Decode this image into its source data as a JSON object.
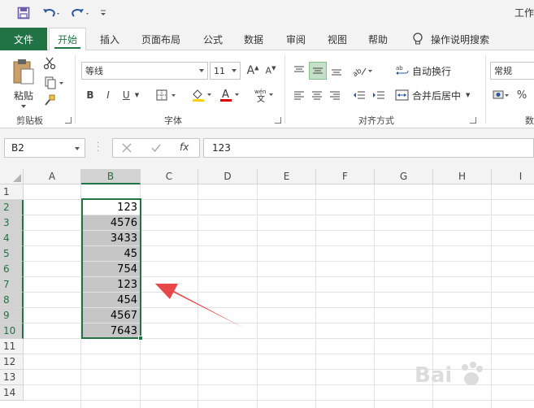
{
  "window": {
    "title_fragment": "工作"
  },
  "ribbon_tabs": [
    {
      "label": "文件"
    },
    {
      "label": "开始"
    },
    {
      "label": "插入"
    },
    {
      "label": "页面布局"
    },
    {
      "label": "公式"
    },
    {
      "label": "数据"
    },
    {
      "label": "审阅"
    },
    {
      "label": "视图"
    },
    {
      "label": "帮助"
    },
    {
      "label": "操作说明搜索"
    }
  ],
  "clipboard": {
    "paste_label": "粘贴",
    "group_label": "剪贴板"
  },
  "font_group": {
    "font_name": "等线",
    "font_size": "11",
    "bold": "B",
    "italic": "I",
    "underline": "U",
    "group_label": "字体"
  },
  "align_group": {
    "wrap_text": "自动换行",
    "merge_center": "合并后居中",
    "group_label": "对齐方式"
  },
  "number_group": {
    "format": "常规",
    "percent": "%",
    "group_label_fragment": "数"
  },
  "formula_bar": {
    "name_box": "B2",
    "fx": "fx",
    "formula": "123"
  },
  "sheet": {
    "columns": [
      "A",
      "B",
      "C",
      "D",
      "E",
      "F",
      "G",
      "H",
      "I"
    ],
    "rows": [
      "1",
      "2",
      "3",
      "4",
      "5",
      "6",
      "7",
      "8",
      "9",
      "10",
      "11",
      "12",
      "13",
      "14"
    ],
    "b_values": [
      "123",
      "4576",
      "3433",
      "45",
      "754",
      "123",
      "454",
      "4567",
      "7643"
    ]
  },
  "colors": {
    "accent": "#217346",
    "arrow": "#e8474a"
  }
}
